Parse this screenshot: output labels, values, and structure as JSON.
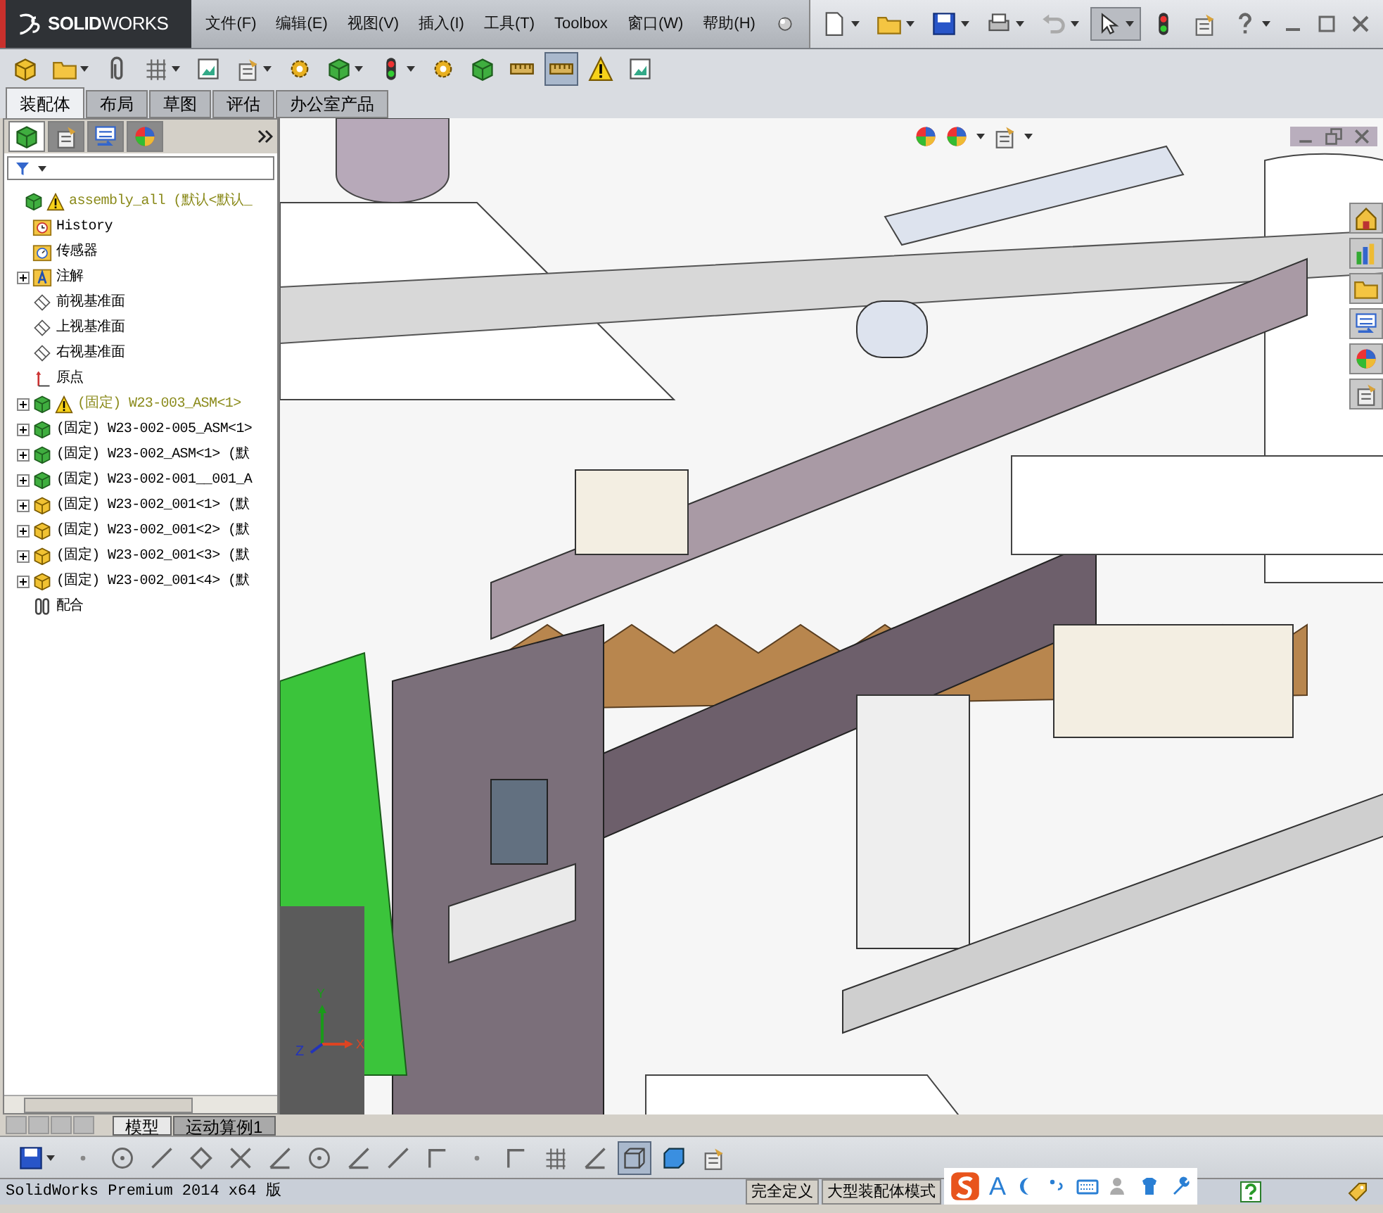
{
  "window": {
    "logo": "**SOLID**WORKS"
  },
  "menu": [
    "文件(F)",
    "编辑(E)",
    "视图(V)",
    "插入(I)",
    "工具(T)",
    "Toolbox",
    "窗口(W)",
    "帮助(H)"
  ],
  "quick_access": [
    {
      "pressed": false
    },
    {
      "pressed": false
    },
    {
      "pressed": false
    },
    {
      "pressed": false
    },
    {
      "pressed": false
    },
    {
      "pressed": true
    },
    {
      "pressed": false
    },
    {
      "pressed": false
    },
    {
      "pressed": false
    }
  ],
  "command_toolbar": [
    {
      "pressed": false
    },
    {
      "pressed": false
    },
    {
      "pressed": false
    },
    {
      "pressed": false
    },
    {
      "pressed": false
    },
    {
      "pressed": false
    },
    {
      "pressed": false
    },
    {
      "pressed": false
    },
    {
      "pressed": false
    },
    {
      "pressed": false
    },
    {
      "pressed": false
    },
    {
      "pressed": false
    },
    {
      "pressed": true
    },
    {
      "pressed": false
    },
    {
      "pressed": false
    }
  ],
  "tabs": [
    {
      "label": "装配体",
      "selected": true
    },
    {
      "label": "布局",
      "selected": false
    },
    {
      "label": "草图",
      "selected": false
    },
    {
      "label": "评估",
      "selected": false
    },
    {
      "label": "办公室产品",
      "selected": false
    }
  ],
  "panel_tabs": [
    {
      "selected": true
    },
    {
      "selected": false
    },
    {
      "selected": false
    },
    {
      "selected": false
    }
  ],
  "tree": {
    "kind": "assembly",
    "label": "assembly_all (默认<默认_",
    "warning": true,
    "collapsed": false,
    "children": [
      {
        "kind": "history",
        "label": "History",
        "warning": false,
        "collapsed": false
      },
      {
        "kind": "sensor",
        "label": "传感器",
        "warning": false,
        "collapsed": false
      },
      {
        "kind": "annotation",
        "label": "注解",
        "warning": false,
        "collapsed": true
      },
      {
        "kind": "plane",
        "label": "前视基准面",
        "warning": false,
        "collapsed": false
      },
      {
        "kind": "plane",
        "label": "上视基准面",
        "warning": false,
        "collapsed": false
      },
      {
        "kind": "plane",
        "label": "右视基准面",
        "warning": false,
        "collapsed": false
      },
      {
        "kind": "origin",
        "label": "原点",
        "warning": false,
        "collapsed": false
      },
      {
        "kind": "assembly",
        "label": "(固定) W23-003_ASM<1>",
        "warning": true,
        "collapsed": true
      },
      {
        "kind": "assembly",
        "label": "(固定) W23-002-005_ASM<1>",
        "warning": false,
        "collapsed": true
      },
      {
        "kind": "assembly",
        "label": "(固定) W23-002_ASM<1> (默",
        "warning": false,
        "collapsed": true
      },
      {
        "kind": "assembly",
        "label": "(固定) W23-002-001__001_A",
        "warning": false,
        "collapsed": true
      },
      {
        "kind": "part",
        "label": "(固定) W23-002_001<1> (默",
        "warning": false,
        "collapsed": true
      },
      {
        "kind": "part",
        "label": "(固定) W23-002_001<2> (默",
        "warning": false,
        "collapsed": true
      },
      {
        "kind": "part",
        "label": "(固定) W23-002_001<3> (默",
        "warning": false,
        "collapsed": true
      },
      {
        "kind": "part",
        "label": "(固定) W23-002_001<4> (默",
        "warning": false,
        "collapsed": true
      },
      {
        "kind": "mates",
        "label": "配合",
        "warning": false,
        "collapsed": false
      }
    ]
  },
  "triad": {
    "x": "X",
    "y": "Y",
    "z": "Z"
  },
  "bottom_tabs": [
    {
      "label": "模型",
      "selected": true
    },
    {
      "label": "运动算例1",
      "selected": false
    }
  ],
  "sketch_toolbar": [
    {
      "pressed": false
    },
    {
      "pressed": false
    },
    {
      "pressed": false
    },
    {
      "pressed": false
    },
    {
      "pressed": false
    },
    {
      "pressed": false
    },
    {
      "pressed": false
    },
    {
      "pressed": false
    },
    {
      "pressed": false
    },
    {
      "pressed": false
    },
    {
      "pressed": false
    },
    {
      "pressed": false
    },
    {
      "pressed": false
    },
    {
      "pressed": false
    },
    {
      "pressed": false
    },
    {
      "pressed": true
    },
    {
      "pressed": false
    },
    {
      "pressed": false
    }
  ],
  "status_bar": {
    "product": "SolidWorks Premium 2014 x64 版",
    "fields": [
      "完全定义",
      "大型装配体模式"
    ]
  },
  "ime_bar": {
    "mode": "A"
  }
}
